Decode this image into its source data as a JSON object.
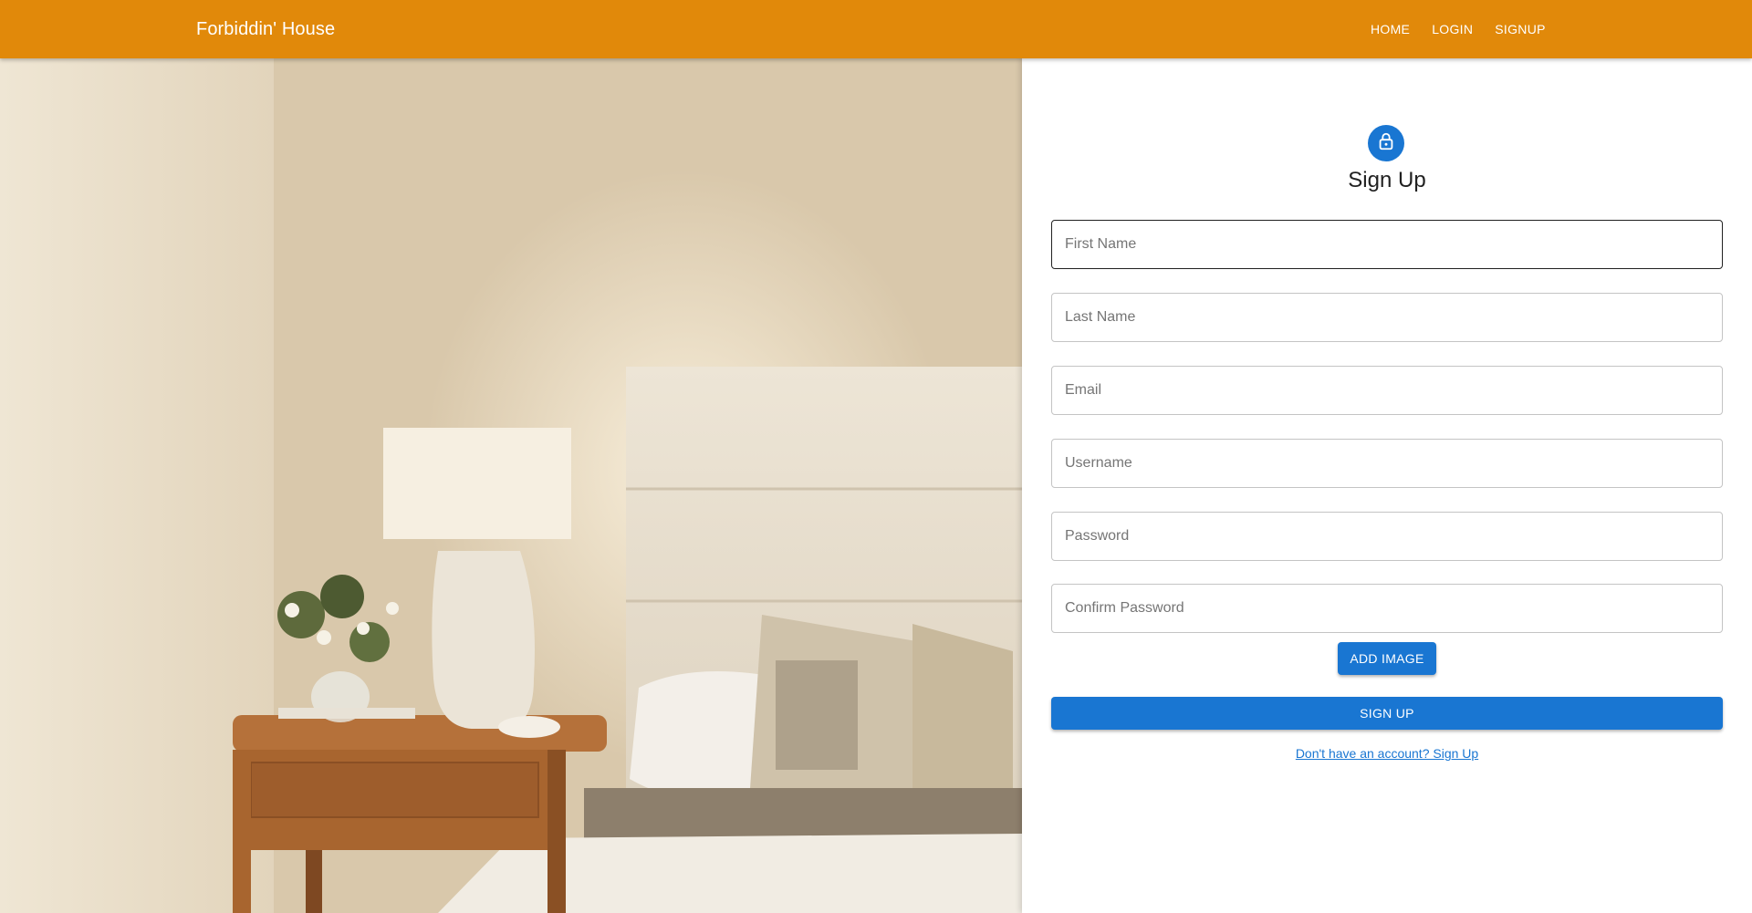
{
  "app": {
    "brand": "Forbiddin' House"
  },
  "nav": {
    "items": [
      "HOME",
      "LOGIN",
      "SIGNUP"
    ]
  },
  "form": {
    "title": "Sign Up",
    "fields": [
      {
        "placeholder": "First Name",
        "value": ""
      },
      {
        "placeholder": "Last Name",
        "value": ""
      },
      {
        "placeholder": "Email",
        "value": ""
      },
      {
        "placeholder": "Username",
        "value": ""
      },
      {
        "placeholder": "Password",
        "value": ""
      },
      {
        "placeholder": "Confirm Password",
        "value": ""
      }
    ],
    "add_image_label": "ADD IMAGE",
    "submit_label": "SIGN UP",
    "account_link": "Don't have an account? Sign Up",
    "avatar_icon": "lock-icon"
  },
  "colors": {
    "appbar": "#e1890a",
    "primary": "#1976d2",
    "text": "#212121"
  },
  "hero": {
    "image_subject": "bedroom-photo"
  }
}
